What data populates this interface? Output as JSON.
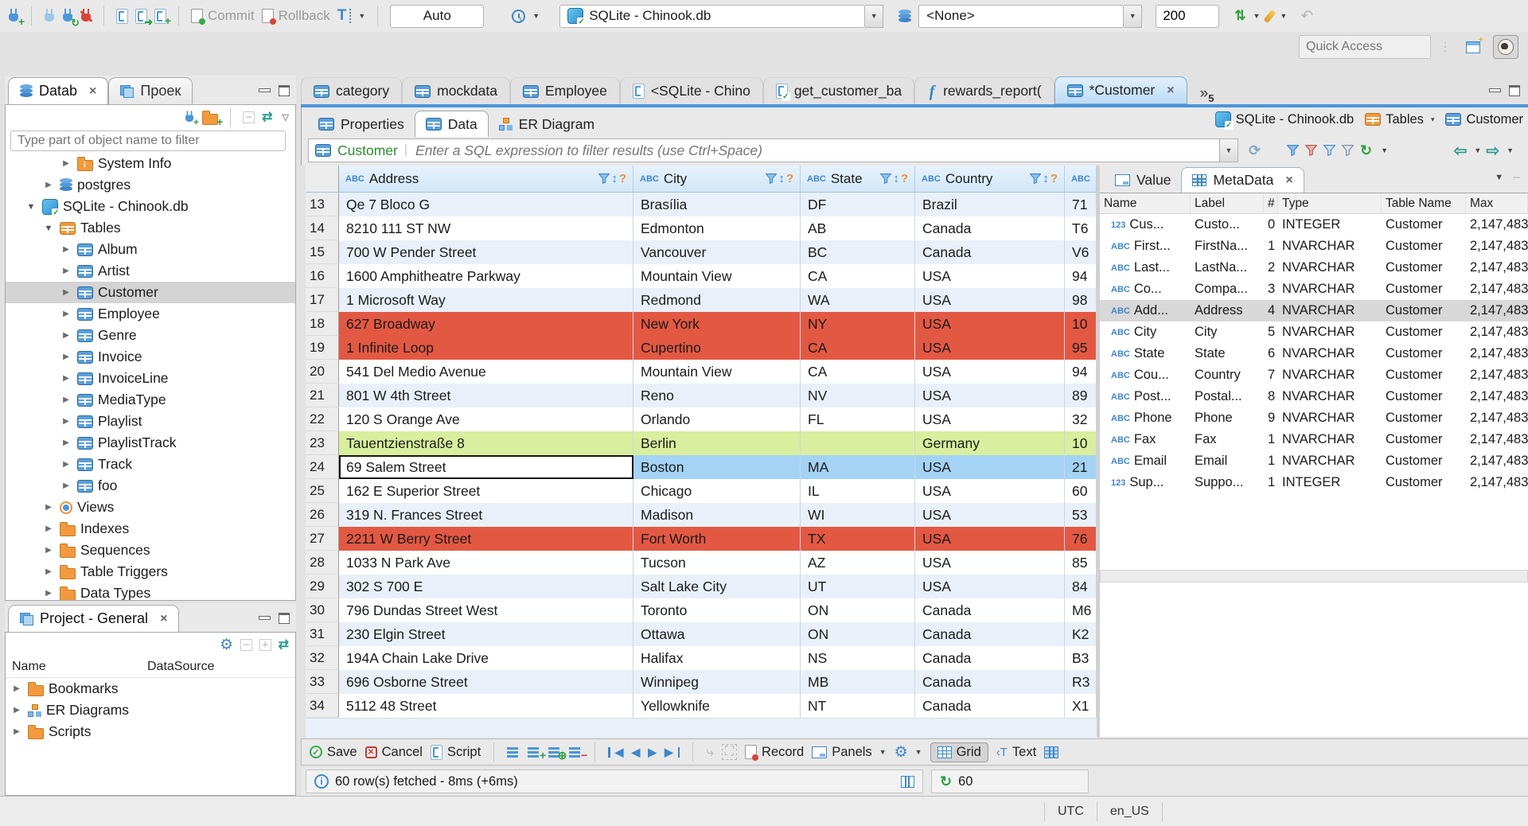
{
  "toolbar": {
    "commit": "Commit",
    "rollback": "Rollback",
    "auto_mode": "Auto",
    "connection": "SQLite - Chinook.db",
    "schema": "<None>",
    "fetch_size": "200",
    "quick_access_placeholder": "Quick Access"
  },
  "editor_tabs": {
    "overflow_count": "5",
    "tabs": [
      {
        "label": "category",
        "icon": "table-icon",
        "active": false
      },
      {
        "label": "mockdata",
        "icon": "table-icon",
        "active": false
      },
      {
        "label": "Employee",
        "icon": "table-icon",
        "active": false
      },
      {
        "label": "<SQLite - Chino",
        "icon": "sql-script-icon",
        "active": false
      },
      {
        "label": "get_customer_ba",
        "icon": "sql-script-check-icon",
        "active": false
      },
      {
        "label": "rewards_report(",
        "icon": "function-icon",
        "active": false
      },
      {
        "label": "*Customer",
        "icon": "table-icon",
        "active": true,
        "closable": true
      }
    ]
  },
  "navigator": {
    "tab_database": "Datab",
    "tab_project": "Проек",
    "filter_placeholder": "Type part of object name to filter",
    "tree": [
      {
        "label": "System Info",
        "icon": "info-folder-icon",
        "indent": 3,
        "state": "collapsed",
        "selected": false
      },
      {
        "label": "postgres",
        "icon": "database-icon",
        "indent": 2,
        "state": "collapsed",
        "selected": false
      },
      {
        "label": "SQLite - Chinook.db",
        "icon": "sqlite-db-icon",
        "indent": 1,
        "state": "expanded",
        "selected": false
      },
      {
        "label": "Tables",
        "icon": "tables-folder-icon",
        "indent": 2,
        "state": "expanded",
        "selected": false
      },
      {
        "label": "Album",
        "icon": "table-icon",
        "indent": 3,
        "state": "collapsed",
        "selected": false
      },
      {
        "label": "Artist",
        "icon": "table-icon",
        "indent": 3,
        "state": "collapsed",
        "selected": false
      },
      {
        "label": "Customer",
        "icon": "table-icon",
        "indent": 3,
        "state": "collapsed",
        "selected": true
      },
      {
        "label": "Employee",
        "icon": "table-icon",
        "indent": 3,
        "state": "collapsed",
        "selected": false
      },
      {
        "label": "Genre",
        "icon": "table-icon",
        "indent": 3,
        "state": "collapsed",
        "selected": false
      },
      {
        "label": "Invoice",
        "icon": "table-icon",
        "indent": 3,
        "state": "collapsed",
        "selected": false
      },
      {
        "label": "InvoiceLine",
        "icon": "table-icon",
        "indent": 3,
        "state": "collapsed",
        "selected": false
      },
      {
        "label": "MediaType",
        "icon": "table-icon",
        "indent": 3,
        "state": "collapsed",
        "selected": false
      },
      {
        "label": "Playlist",
        "icon": "table-icon",
        "indent": 3,
        "state": "collapsed",
        "selected": false
      },
      {
        "label": "PlaylistTrack",
        "icon": "table-icon",
        "indent": 3,
        "state": "collapsed",
        "selected": false
      },
      {
        "label": "Track",
        "icon": "table-icon",
        "indent": 3,
        "state": "collapsed",
        "selected": false
      },
      {
        "label": "foo",
        "icon": "table-icon",
        "indent": 3,
        "state": "collapsed",
        "selected": false
      },
      {
        "label": "Views",
        "icon": "views-icon",
        "indent": 2,
        "state": "collapsed",
        "selected": false
      },
      {
        "label": "Indexes",
        "icon": "folder-icon",
        "indent": 2,
        "state": "collapsed",
        "selected": false
      },
      {
        "label": "Sequences",
        "icon": "folder-icon",
        "indent": 2,
        "state": "collapsed",
        "selected": false
      },
      {
        "label": "Table Triggers",
        "icon": "folder-icon",
        "indent": 2,
        "state": "collapsed",
        "selected": false
      },
      {
        "label": "Data Types",
        "icon": "folder-icon",
        "indent": 2,
        "state": "collapsed",
        "selected": false
      }
    ]
  },
  "project_panel": {
    "title": "Project - General",
    "columns": [
      "Name",
      "DataSource"
    ],
    "items": [
      {
        "label": "Bookmarks",
        "icon": "folder-icon"
      },
      {
        "label": "ER Diagrams",
        "icon": "er-diagram-icon"
      },
      {
        "label": "Scripts",
        "icon": "folder-icon"
      }
    ]
  },
  "result_view": {
    "tabs": [
      {
        "label": "Properties",
        "icon": "table-icon",
        "active": false
      },
      {
        "label": "Data",
        "icon": "table-icon",
        "active": true
      },
      {
        "label": "ER Diagram",
        "icon": "er-diagram-icon",
        "active": false
      }
    ],
    "breadcrumb": [
      {
        "label": "SQLite - Chinook.db",
        "icon": "sqlite-db-icon",
        "dropdown": false
      },
      {
        "label": "Tables",
        "icon": "tables-folder-icon",
        "dropdown": true
      },
      {
        "label": "Customer",
        "icon": "table-icon",
        "dropdown": false
      }
    ],
    "filter_table": "Customer",
    "filter_placeholder": "Enter a SQL expression to filter results (use Ctrl+Space)"
  },
  "grid": {
    "columns": [
      {
        "label": "Address",
        "type": "ABC"
      },
      {
        "label": "City",
        "type": "ABC"
      },
      {
        "label": "State",
        "type": "ABC"
      },
      {
        "label": "Country",
        "type": "ABC"
      },
      {
        "label": "",
        "type": "ABC"
      }
    ],
    "rows": [
      {
        "num": "13",
        "address": "Qe 7 Bloco G",
        "city": "Brasília",
        "state": "DF",
        "country": "Brazil",
        "postal": "71",
        "highlight": "alt"
      },
      {
        "num": "14",
        "address": "8210 111 ST NW",
        "city": "Edmonton",
        "state": "AB",
        "country": "Canada",
        "postal": "T6",
        "highlight": "plain"
      },
      {
        "num": "15",
        "address": "700 W Pender Street",
        "city": "Vancouver",
        "state": "BC",
        "country": "Canada",
        "postal": "V6",
        "highlight": "alt"
      },
      {
        "num": "16",
        "address": "1600 Amphitheatre Parkway",
        "city": "Mountain View",
        "state": "CA",
        "country": "USA",
        "postal": "94",
        "highlight": "plain"
      },
      {
        "num": "17",
        "address": "1 Microsoft Way",
        "city": "Redmond",
        "state": "WA",
        "country": "USA",
        "postal": "98",
        "highlight": "alt"
      },
      {
        "num": "18",
        "address": "627 Broadway",
        "city": "New York",
        "state": "NY",
        "country": "USA",
        "postal": "10",
        "highlight": "red"
      },
      {
        "num": "19",
        "address": "1 Infinite Loop",
        "city": "Cupertino",
        "state": "CA",
        "country": "USA",
        "postal": "95",
        "highlight": "red"
      },
      {
        "num": "20",
        "address": "541 Del Medio Avenue",
        "city": "Mountain View",
        "state": "CA",
        "country": "USA",
        "postal": "94",
        "highlight": "plain"
      },
      {
        "num": "21",
        "address": "801 W 4th Street",
        "city": "Reno",
        "state": "NV",
        "country": "USA",
        "postal": "89",
        "highlight": "alt"
      },
      {
        "num": "22",
        "address": "120 S Orange Ave",
        "city": "Orlando",
        "state": "FL",
        "country": "USA",
        "postal": "32",
        "highlight": "plain"
      },
      {
        "num": "23",
        "address": "Tauentzienstraße 8",
        "city": "Berlin",
        "state": "",
        "country": "Germany",
        "postal": "10",
        "highlight": "green"
      },
      {
        "num": "24",
        "address": "69 Salem Street",
        "city": "Boston",
        "state": "MA",
        "country": "USA",
        "postal": "21",
        "highlight": "selected"
      },
      {
        "num": "25",
        "address": "162 E Superior Street",
        "city": "Chicago",
        "state": "IL",
        "country": "USA",
        "postal": "60",
        "highlight": "plain"
      },
      {
        "num": "26",
        "address": "319 N. Frances Street",
        "city": "Madison",
        "state": "WI",
        "country": "USA",
        "postal": "53",
        "highlight": "alt"
      },
      {
        "num": "27",
        "address": "2211 W Berry Street",
        "city": "Fort Worth",
        "state": "TX",
        "country": "USA",
        "postal": "76",
        "highlight": "red"
      },
      {
        "num": "28",
        "address": "1033 N Park Ave",
        "city": "Tucson",
        "state": "AZ",
        "country": "USA",
        "postal": "85",
        "highlight": "plain"
      },
      {
        "num": "29",
        "address": "302 S 700 E",
        "city": "Salt Lake City",
        "state": "UT",
        "country": "USA",
        "postal": "84",
        "highlight": "alt"
      },
      {
        "num": "30",
        "address": "796 Dundas Street West",
        "city": "Toronto",
        "state": "ON",
        "country": "Canada",
        "postal": "M6",
        "highlight": "plain"
      },
      {
        "num": "31",
        "address": "230 Elgin Street",
        "city": "Ottawa",
        "state": "ON",
        "country": "Canada",
        "postal": "K2",
        "highlight": "alt"
      },
      {
        "num": "32",
        "address": "194A Chain Lake Drive",
        "city": "Halifax",
        "state": "NS",
        "country": "Canada",
        "postal": "B3",
        "highlight": "plain"
      },
      {
        "num": "33",
        "address": "696 Osborne Street",
        "city": "Winnipeg",
        "state": "MB",
        "country": "Canada",
        "postal": "R3",
        "highlight": "alt"
      },
      {
        "num": "34",
        "address": "5112 48 Street",
        "city": "Yellowknife",
        "state": "NT",
        "country": "Canada",
        "postal": "X1",
        "highlight": "plain"
      }
    ]
  },
  "metadata_panel": {
    "tab_value": "Value",
    "tab_metadata": "MetaData",
    "columns": [
      "Name",
      "Label",
      "#",
      "Type",
      "Table Name",
      "Max"
    ],
    "rows": [
      {
        "type_icon": "123",
        "name": "Cus...",
        "label": "Custo...",
        "num": "0",
        "type": "INTEGER",
        "table": "Customer",
        "max": "2,147,483",
        "selected": false
      },
      {
        "type_icon": "ABC",
        "name": "First...",
        "label": "FirstNa...",
        "num": "1",
        "type": "NVARCHAR",
        "table": "Customer",
        "max": "2,147,483",
        "selected": false
      },
      {
        "type_icon": "ABC",
        "name": "Last...",
        "label": "LastNa...",
        "num": "2",
        "type": "NVARCHAR",
        "table": "Customer",
        "max": "2,147,483",
        "selected": false
      },
      {
        "type_icon": "ABC",
        "name": "Co...",
        "label": "Compa...",
        "num": "3",
        "type": "NVARCHAR",
        "table": "Customer",
        "max": "2,147,483",
        "selected": false
      },
      {
        "type_icon": "ABC",
        "name": "Add...",
        "label": "Address",
        "num": "4",
        "type": "NVARCHAR",
        "table": "Customer",
        "max": "2,147,483",
        "selected": true
      },
      {
        "type_icon": "ABC",
        "name": "City",
        "label": "City",
        "num": "5",
        "type": "NVARCHAR",
        "table": "Customer",
        "max": "2,147,483",
        "selected": false
      },
      {
        "type_icon": "ABC",
        "name": "State",
        "label": "State",
        "num": "6",
        "type": "NVARCHAR",
        "table": "Customer",
        "max": "2,147,483",
        "selected": false
      },
      {
        "type_icon": "ABC",
        "name": "Cou...",
        "label": "Country",
        "num": "7",
        "type": "NVARCHAR",
        "table": "Customer",
        "max": "2,147,483",
        "selected": false
      },
      {
        "type_icon": "ABC",
        "name": "Post...",
        "label": "Postal...",
        "num": "8",
        "type": "NVARCHAR",
        "table": "Customer",
        "max": "2,147,483",
        "selected": false
      },
      {
        "type_icon": "ABC",
        "name": "Phone",
        "label": "Phone",
        "num": "9",
        "type": "NVARCHAR",
        "table": "Customer",
        "max": "2,147,483",
        "selected": false
      },
      {
        "type_icon": "ABC",
        "name": "Fax",
        "label": "Fax",
        "num": "1",
        "type": "NVARCHAR",
        "table": "Customer",
        "max": "2,147,483",
        "selected": false
      },
      {
        "type_icon": "ABC",
        "name": "Email",
        "label": "Email",
        "num": "1",
        "type": "NVARCHAR",
        "table": "Customer",
        "max": "2,147,483",
        "selected": false
      },
      {
        "type_icon": "123",
        "name": "Sup...",
        "label": "Suppo...",
        "num": "1",
        "type": "INTEGER",
        "table": "Customer",
        "max": "2,147,483",
        "selected": false
      }
    ]
  },
  "result_toolbar": {
    "save": "Save",
    "cancel": "Cancel",
    "script": "Script",
    "record": "Record",
    "panels": "Panels",
    "grid": "Grid",
    "text": "Text"
  },
  "status_bar": {
    "fetch_message": "60 row(s) fetched - 8ms (+6ms)",
    "refresh_value": "60"
  },
  "app_bar": {
    "timezone": "UTC",
    "locale": "en_US"
  },
  "colors": {
    "accent": "#3f87c9",
    "row_red": "#e35843",
    "row_green": "#d9ee9e",
    "row_selected": "#a4d3f6"
  }
}
